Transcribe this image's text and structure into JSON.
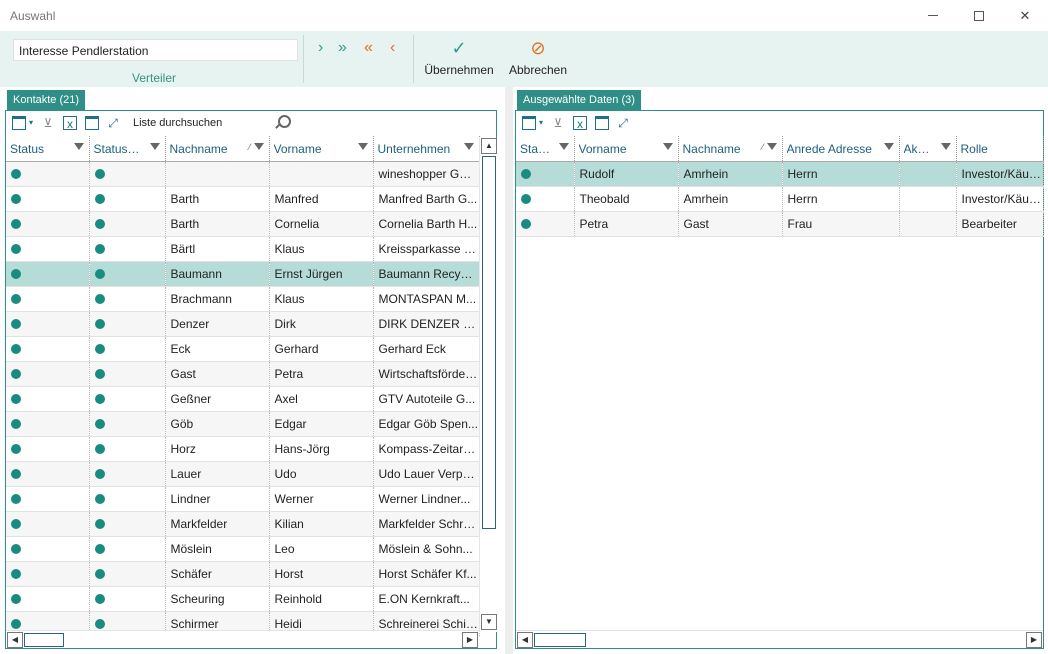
{
  "window": {
    "title": "Auswahl"
  },
  "ribbon": {
    "input_value": "Interesse Pendlerstation",
    "group_label": "Verteiler",
    "buttons": [
      {
        "label": "Übernehmen",
        "icon": "check-icon"
      },
      {
        "label": "Abbrechen",
        "icon": "cancel-icon"
      }
    ],
    "arrows": [
      "›",
      "»",
      "«",
      "‹"
    ]
  },
  "colors": {
    "accent": "#2f8f86",
    "status_dot": "#1a8b7f",
    "selection": "#b6dcd8",
    "orange": "#e07020"
  },
  "left": {
    "tab": "Kontakte (21)",
    "search_label": "Liste durchsuchen",
    "columns": [
      "Status",
      "Status U...",
      "Nachname",
      "Vorname",
      "Unternehmen"
    ],
    "rows": [
      {
        "nachname": "",
        "vorname": "",
        "unternehmen": "wineshopper Gm..."
      },
      {
        "nachname": "Barth",
        "vorname": "Manfred",
        "unternehmen": "Manfred Barth G..."
      },
      {
        "nachname": "Barth",
        "vorname": "Cornelia",
        "unternehmen": "Cornelia Barth H..."
      },
      {
        "nachname": "Bärtl",
        "vorname": "Klaus",
        "unternehmen": "Kreissparkasse S..."
      },
      {
        "nachname": "Baumann",
        "vorname": "Ernst Jürgen",
        "unternehmen": "Baumann Recycl...",
        "selected": true
      },
      {
        "nachname": "Brachmann",
        "vorname": "Klaus",
        "unternehmen": "MONTASPAN M..."
      },
      {
        "nachname": "Denzer",
        "vorname": "Dirk",
        "unternehmen": "DIRK DENZER V..."
      },
      {
        "nachname": "Eck",
        "vorname": "Gerhard",
        "unternehmen": "Gerhard Eck"
      },
      {
        "nachname": "Gast",
        "vorname": "Petra",
        "unternehmen": "Wirtschaftsförder..."
      },
      {
        "nachname": "Geßner",
        "vorname": "Axel",
        "unternehmen": "GTV Autoteile G..."
      },
      {
        "nachname": "Göb",
        "vorname": "Edgar",
        "unternehmen": "Edgar Göb Spen..."
      },
      {
        "nachname": "Horz",
        "vorname": "Hans-Jörg",
        "unternehmen": "Kompass-Zeitarb..."
      },
      {
        "nachname": "Lauer",
        "vorname": "Udo",
        "unternehmen": "Udo Lauer Verpu..."
      },
      {
        "nachname": "Lindner",
        "vorname": "Werner",
        "unternehmen": "Werner Lindner..."
      },
      {
        "nachname": "Markfelder",
        "vorname": "Kilian",
        "unternehmen": "Markfelder Schre..."
      },
      {
        "nachname": "Möslein",
        "vorname": "Leo",
        "unternehmen": "Möslein & Sohn..."
      },
      {
        "nachname": "Schäfer",
        "vorname": "Horst",
        "unternehmen": "Horst Schäfer Kf..."
      },
      {
        "nachname": "Scheuring",
        "vorname": "Reinhold",
        "unternehmen": "E.ON Kernkraft..."
      },
      {
        "nachname": "Schirmer",
        "vorname": "Heidi",
        "unternehmen": "Schreinerei Schir..."
      }
    ]
  },
  "right": {
    "tab": "Ausgewählte Daten (3)",
    "columns": [
      "Status",
      "Vorname",
      "Nachname",
      "Anrede Adresse",
      "Akad...",
      "Rolle"
    ],
    "rows": [
      {
        "vorname": "Rudolf",
        "nachname": "Amrhein",
        "anrede": "Herrn",
        "akad": "",
        "rolle": "Investor/Käufer",
        "selected": true
      },
      {
        "vorname": "Theobald",
        "nachname": "Amrhein",
        "anrede": "Herrn",
        "akad": "",
        "rolle": "Investor/Käufer"
      },
      {
        "vorname": "Petra",
        "nachname": "Gast",
        "anrede": "Frau",
        "akad": "",
        "rolle": "Bearbeiter"
      }
    ]
  }
}
